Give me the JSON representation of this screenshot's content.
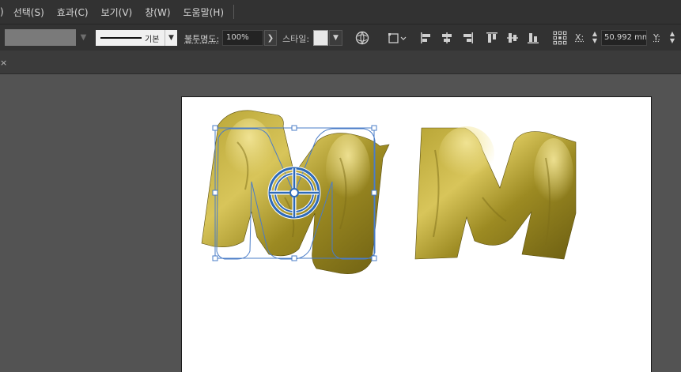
{
  "menubar": {
    "stub": ")",
    "items": [
      "선택(S)",
      "효과(C)",
      "보기(V)",
      "창(W)",
      "도움말(H)"
    ]
  },
  "controlbar": {
    "stroke_profile_label": "기본",
    "opacity_label": "불투명도:",
    "opacity_value": "100%",
    "style_label": "스타일:",
    "x_label": "X:",
    "x_value": "50.992 mm",
    "y_label": "Y:"
  },
  "colors": {
    "chrome_dark": "#323232",
    "canvas_bg": "#535353",
    "selection": "#4a7cc7",
    "gold_light": "#d8c55a",
    "gold_dark": "#6d5f12"
  },
  "icons": [
    "chevron-down-icon",
    "chevron-right-icon",
    "globe-icon",
    "transform-icon",
    "align-left-icon",
    "align-center-icon",
    "align-right-icon",
    "align-top-icon",
    "align-middle-icon",
    "align-bottom-icon",
    "reference-point-icon",
    "close-icon"
  ]
}
